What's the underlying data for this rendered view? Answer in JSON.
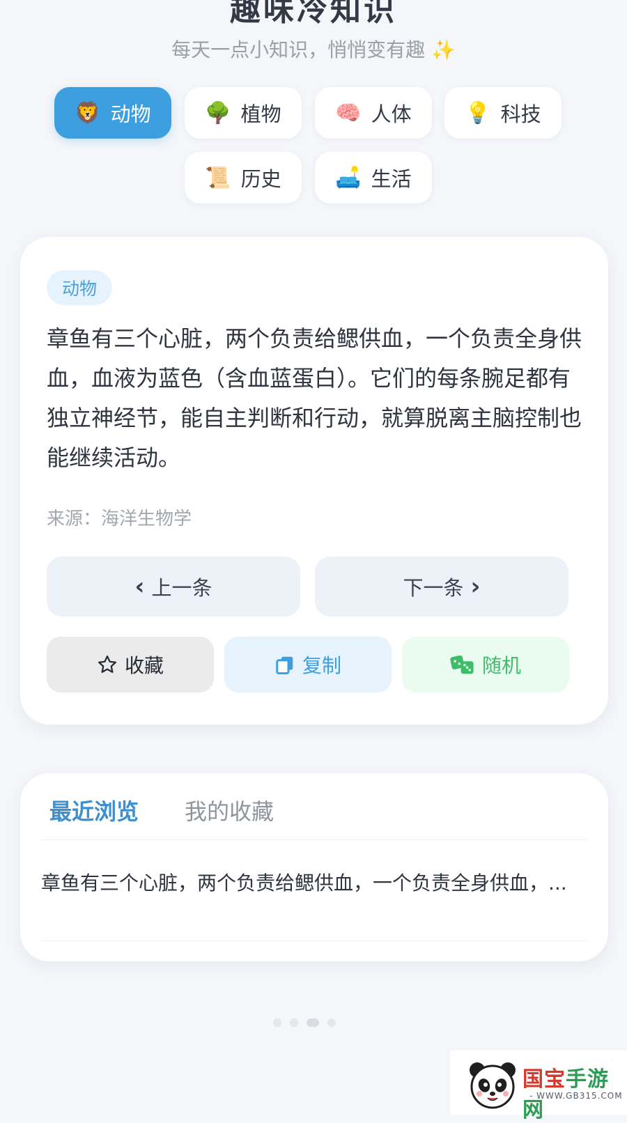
{
  "app": {
    "title": "趣味冷知识",
    "subtitle": "每天一点小知识，悄悄变有趣 ✨"
  },
  "categories": [
    {
      "icon": "🦁",
      "label": "动物",
      "active": true
    },
    {
      "icon": "🌳",
      "label": "植物",
      "active": false
    },
    {
      "icon": "🧠",
      "label": "人体",
      "active": false
    },
    {
      "icon": "💡",
      "label": "科技",
      "active": false
    },
    {
      "icon": "📜",
      "label": "历史",
      "active": false
    },
    {
      "icon": "🛋️",
      "label": "生活",
      "active": false
    }
  ],
  "fact_card": {
    "tag": "动物",
    "text": "章鱼有三个心脏，两个负责给鳃供血，一个负责全身供血，血液为蓝色（含血蓝蛋白）。它们的每条腕足都有独立神经节，能自主判断和行动，就算脱离主脑控制也能继续活动。",
    "source": "来源：海洋生物学",
    "prev_label": "上一条",
    "next_label": "下一条",
    "favorite_label": "收藏",
    "copy_label": "复制",
    "random_label": "随机"
  },
  "history": {
    "tabs": [
      {
        "label": "最近浏览",
        "active": true
      },
      {
        "label": "我的收藏",
        "active": false
      }
    ],
    "items": [
      "章鱼有三个心脏，两个负责给鳃供血，一个负责全身供血，..."
    ]
  },
  "watermark": {
    "name_red": "国宝",
    "name_green": "手游网",
    "url": "- WWW.GB315.COM -"
  },
  "colors": {
    "accent": "#3d9ee0",
    "background": "#f4f6fa",
    "copy_text": "#3d9ee0",
    "random_text": "#3dbd6a"
  }
}
